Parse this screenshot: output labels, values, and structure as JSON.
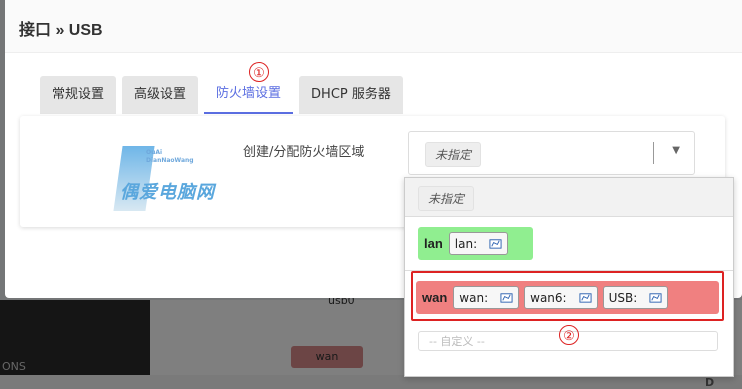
{
  "modal": {
    "title": "接口 » USB",
    "tabs": [
      {
        "label": "常规设置",
        "active": false
      },
      {
        "label": "高级设置",
        "active": false
      },
      {
        "label": "防火墙设置",
        "active": true
      },
      {
        "label": "DHCP 服务器",
        "active": false
      }
    ]
  },
  "form": {
    "label": "创建/分配防火墙区域",
    "selected": "未指定"
  },
  "logo": {
    "small_line1": "OuAi",
    "small_line2": "DianNaoWang",
    "big": "偶爱电脑网"
  },
  "dropdown": {
    "header_option": "未指定",
    "zones": [
      {
        "name": "lan",
        "color": "#90ee90",
        "interfaces": [
          "lan:"
        ]
      },
      {
        "name": "wan",
        "color": "#f08080",
        "interfaces": [
          "wan:",
          "wan6:",
          "USB:"
        ]
      }
    ],
    "custom_placeholder": "-- 自定义 --"
  },
  "annotations": {
    "marker1": "①",
    "marker2": "②"
  },
  "background": {
    "usb_label": "usb0",
    "wan_badge": "wan",
    "left_text": "ONS",
    "right_text": "协议: D"
  },
  "colors": {
    "accent": "#5b6ee1",
    "lan_zone": "#90ee90",
    "wan_zone": "#f08080",
    "highlight": "#dd2222"
  }
}
